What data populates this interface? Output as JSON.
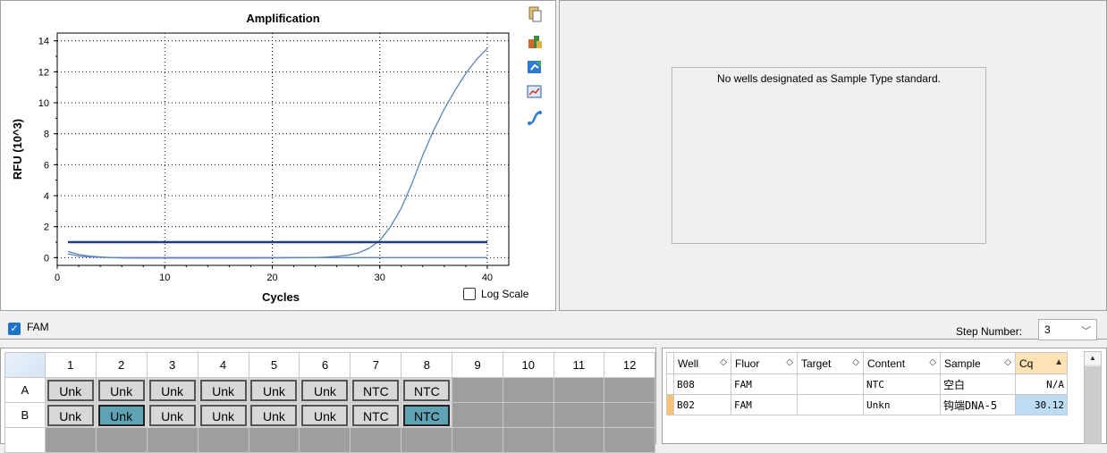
{
  "chart": {
    "title": "Amplification",
    "xlabel": "Cycles",
    "ylabel": "RFU (10^3)",
    "log_scale_label": "Log Scale",
    "log_scale_checked": false
  },
  "chart_data": {
    "type": "line",
    "title": "Amplification",
    "xlabel": "Cycles",
    "ylabel": "RFU (10^3)",
    "xlim": [
      0,
      42
    ],
    "ylim": [
      -0.5,
      14.5
    ],
    "xticks": [
      0,
      10,
      20,
      30,
      40
    ],
    "yticks": [
      0,
      2,
      4,
      6,
      8,
      10,
      12,
      14
    ],
    "grid": true,
    "series": [
      {
        "x": [
          1,
          2,
          3,
          4,
          5,
          6,
          8,
          10,
          12,
          14,
          16,
          18,
          20,
          22,
          24,
          25,
          26,
          27,
          28,
          29,
          30,
          31,
          32,
          33,
          34,
          35,
          36,
          37,
          38,
          39,
          40
        ],
        "y": [
          0.4,
          0.2,
          0.1,
          0.05,
          0.0,
          -0.02,
          -0.03,
          -0.03,
          -0.03,
          -0.03,
          -0.03,
          -0.03,
          -0.02,
          -0.01,
          0.0,
          0.03,
          0.08,
          0.15,
          0.3,
          0.6,
          1.1,
          2.0,
          3.2,
          4.8,
          6.6,
          8.2,
          9.6,
          10.8,
          11.9,
          12.8,
          13.5
        ],
        "color": "#5b84b8"
      },
      {
        "x": [
          1,
          2,
          3,
          4,
          5,
          6,
          8,
          10,
          14,
          20,
          26,
          30,
          34,
          38,
          40
        ],
        "y": [
          0.25,
          0.1,
          0.05,
          0.02,
          0.0,
          0.0,
          0.0,
          0.0,
          0.0,
          0.0,
          0.0,
          0.0,
          0.0,
          0.0,
          0.0
        ],
        "color": "#5b84b8"
      },
      {
        "x": [
          1,
          40
        ],
        "y": [
          1.0,
          1.0
        ],
        "color": "#1f3f7a"
      }
    ]
  },
  "toolbar_icons": [
    "copy-icon",
    "export-excel-icon",
    "export-image-icon",
    "chart-settings-icon",
    "curve-fit-icon"
  ],
  "standard_panel": {
    "message": "No wells designated as Sample Type standard."
  },
  "fluor_filter": {
    "label": "FAM",
    "checked": true
  },
  "step": {
    "label": "Step Number:",
    "value": "3"
  },
  "plate": {
    "columns": [
      "1",
      "2",
      "3",
      "4",
      "5",
      "6",
      "7",
      "8",
      "9",
      "10",
      "11",
      "12"
    ],
    "rows": [
      {
        "label": "A",
        "wells": [
          "Unk",
          "Unk",
          "Unk",
          "Unk",
          "Unk",
          "Unk",
          "NTC",
          "NTC",
          "",
          "",
          "",
          ""
        ],
        "selected": []
      },
      {
        "label": "B",
        "wells": [
          "Unk",
          "Unk",
          "Unk",
          "Unk",
          "Unk",
          "Unk",
          "NTC",
          "NTC",
          "",
          "",
          "",
          ""
        ],
        "selected": [
          1,
          7
        ]
      }
    ]
  },
  "results": {
    "headers": [
      "Well",
      "Fluor",
      "Target",
      "Content",
      "Sample",
      "Cq"
    ],
    "rows": [
      {
        "well": "B08",
        "fluor": "FAM",
        "target": "",
        "content": "NTC",
        "sample": "空白",
        "cq": "N/A"
      },
      {
        "well": "B02",
        "fluor": "FAM",
        "target": "",
        "content": "Unkn",
        "sample": "钩端DNA-5",
        "cq": "30.12"
      }
    ]
  }
}
